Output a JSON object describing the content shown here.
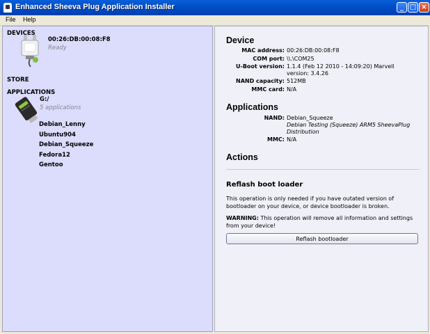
{
  "window": {
    "title": "Enhanced Sheeva Plug Application Installer",
    "buttons": {
      "minimize": "_",
      "maximize": "□",
      "close": "×"
    }
  },
  "menu": [
    "File",
    "Help"
  ],
  "left": {
    "devices_label": "DEVICES",
    "device": {
      "mac": "00:26:DB:00:08:F8",
      "status": "Ready"
    },
    "store_label": "STORE",
    "applications_label": "APPLICATIONS",
    "drive": {
      "path": "G:/",
      "count": "5 applications"
    },
    "apps": [
      "Debian_Lenny",
      "Ubuntu904",
      "Debian_Squeeze",
      "Fedora12",
      "Gentoo"
    ]
  },
  "right": {
    "device_heading": "Device",
    "device_fields": [
      {
        "key": "MAC address:",
        "value": "00:26:DB:00:08:F8"
      },
      {
        "key": "COM port:",
        "value": "\\\\.\\COM25"
      },
      {
        "key": "U-Boot version:",
        "value": "1.1.4 (Feb 12 2010 - 14:09:20) Marvell version: 3.4.26"
      },
      {
        "key": "NAND capacity:",
        "value": "512MB"
      },
      {
        "key": "MMC card:",
        "value": "N/A"
      }
    ],
    "applications_heading": "Applications",
    "nand_key": "NAND:",
    "nand_app": "Debian_Squeeze",
    "nand_desc": "Debian Testing (Squeeze) ARM5 SheevaPlug Distribution",
    "mmc_key": "MMC:",
    "mmc_value": "N/A",
    "actions_heading": "Actions",
    "reflash_heading": "Reflash boot loader",
    "reflash_info": "This operation is only needed if you have outated version of bootloader on your device, or device bootloader is broken.",
    "warning_label": "WARNING:",
    "warning_text": " This operation will remove all information and settings from your device!",
    "reflash_button": "Reflash bootloader"
  }
}
